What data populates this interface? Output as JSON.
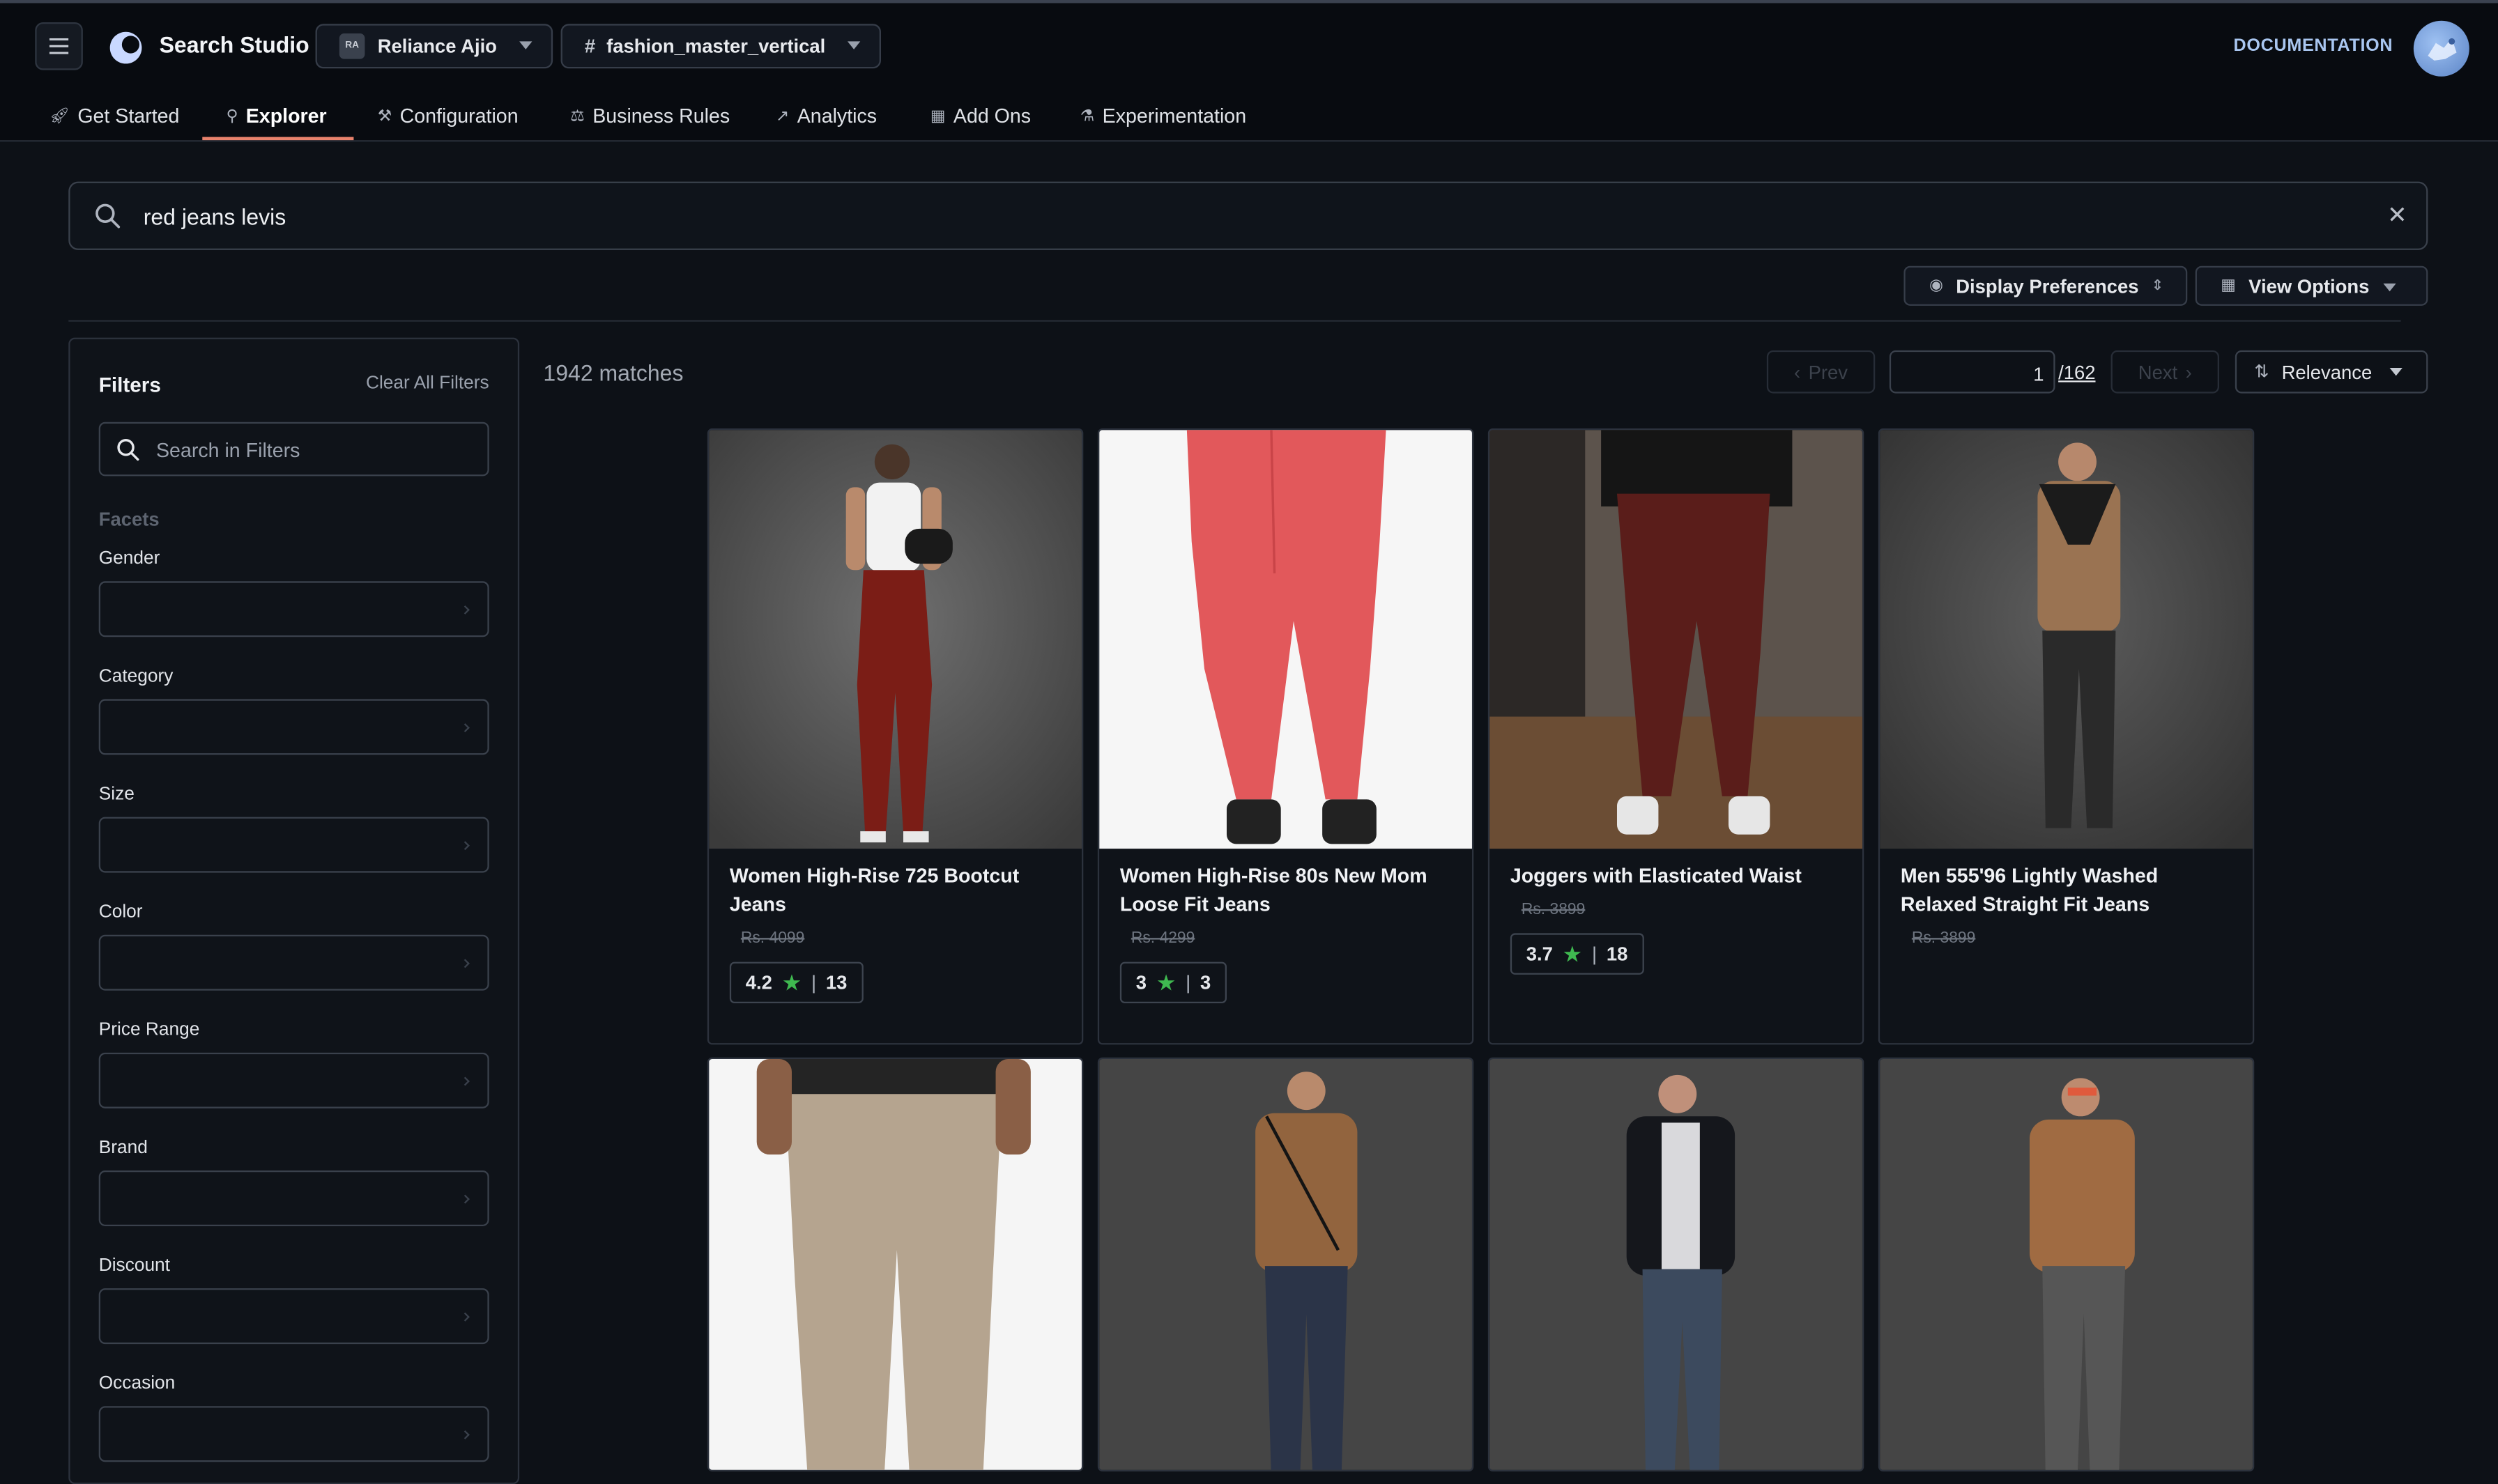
{
  "header": {
    "app_name": "Search Studio",
    "org": {
      "initials": "RA",
      "name": "Reliance Ajio"
    },
    "collection": {
      "prefix": "#",
      "name": "fashion_master_vertical"
    },
    "documentation": "DOCUMENTATION"
  },
  "tabs": [
    {
      "label": "Get Started",
      "icon": "rocket-icon"
    },
    {
      "label": "Explorer",
      "icon": "search-icon",
      "active": true
    },
    {
      "label": "Configuration",
      "icon": "tools-icon"
    },
    {
      "label": "Business Rules",
      "icon": "gavel-icon"
    },
    {
      "label": "Analytics",
      "icon": "trend-icon"
    },
    {
      "label": "Add Ons",
      "icon": "grid-icon"
    },
    {
      "label": "Experimentation",
      "icon": "flask-icon"
    }
  ],
  "search": {
    "query": "red jeans levis"
  },
  "toolbar": {
    "display_preferences": "Display Preferences",
    "view_options": "View Options"
  },
  "filters": {
    "title": "Filters",
    "clear_all": "Clear All Filters",
    "search_placeholder": "Search in Filters",
    "facets_heading": "Facets",
    "facets": [
      "Gender",
      "Category",
      "Size",
      "Color",
      "Price Range",
      "Brand",
      "Discount",
      "Occasion"
    ]
  },
  "results": {
    "matches": "1942 matches",
    "prev": "Prev",
    "next": "Next",
    "page": "1",
    "total_pages": "/162",
    "sort": "Relevance",
    "products": [
      {
        "title": "Women High-Rise 725 Bootcut Jeans",
        "price": "Rs. 4099",
        "rating": "4.2",
        "reviews": "13"
      },
      {
        "title": "Women High-Rise 80s New Mom Loose Fit Jeans",
        "price": "Rs. 4299",
        "rating": "3",
        "reviews": "3"
      },
      {
        "title": "Joggers with Elasticated Waist",
        "price": "Rs. 3899",
        "rating": "3.7",
        "reviews": "18"
      },
      {
        "title": "Men 555'96 Lightly Washed Relaxed Straight Fit Jeans",
        "price": "Rs. 3899"
      }
    ]
  },
  "colors": {
    "accent": "#e8826c",
    "star": "#3fb950",
    "background": "#0d1117"
  }
}
